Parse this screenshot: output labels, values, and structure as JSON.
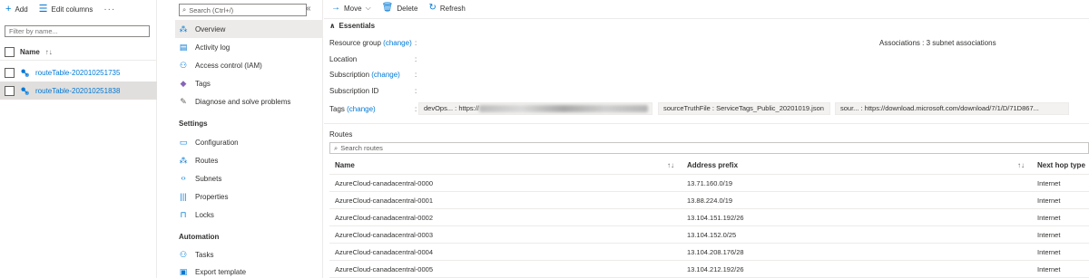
{
  "left_panel": {
    "add_label": "Add",
    "edit_columns_label": "Edit columns",
    "more_label": "···",
    "filter_placeholder": "Filter by name...",
    "name_header": "Name",
    "items": [
      {
        "name": "routeTable-202010251735",
        "selected": false
      },
      {
        "name": "routeTable-202010251838",
        "selected": true
      }
    ]
  },
  "nav": {
    "search_placeholder": "Search (Ctrl+/)",
    "collapse": "«",
    "items": [
      {
        "label": "Overview",
        "icon": "routes-icon"
      },
      {
        "label": "Activity log",
        "icon": "activity-log-icon"
      },
      {
        "label": "Access control (IAM)",
        "icon": "iam-icon"
      },
      {
        "label": "Tags",
        "icon": "tag-icon"
      },
      {
        "label": "Diagnose and solve problems",
        "icon": "wrench-icon"
      }
    ],
    "settings_title": "Settings",
    "settings_items": [
      {
        "label": "Configuration",
        "icon": "configuration-icon"
      },
      {
        "label": "Routes",
        "icon": "routes-icon"
      },
      {
        "label": "Subnets",
        "icon": "subnets-icon"
      },
      {
        "label": "Properties",
        "icon": "properties-icon"
      },
      {
        "label": "Locks",
        "icon": "lock-icon"
      }
    ],
    "automation_title": "Automation",
    "automation_items": [
      {
        "label": "Tasks",
        "icon": "tasks-icon"
      },
      {
        "label": "Export template",
        "icon": "export-template-icon"
      }
    ]
  },
  "toolbar": {
    "move_label": "Move",
    "delete_label": "Delete",
    "refresh_label": "Refresh"
  },
  "essentials": {
    "title": "Essentials",
    "change_label": "(change)",
    "resource_group_label": "Resource group",
    "location_label": "Location",
    "subscription_label": "Subscription",
    "subscription_id_label": "Subscription ID",
    "tags_label": "Tags",
    "colon": ":",
    "associations_label": "Associations",
    "associations_value": "3 subnet associations",
    "tags": [
      {
        "text": "devOps... : https://"
      },
      {
        "text": "sourceTruthFile : ServiceTags_Public_20201019.json"
      },
      {
        "text": "sour... : https://download.microsoft.com/download/7/1/D/71D867..."
      }
    ]
  },
  "routes": {
    "title": "Routes",
    "search_placeholder": "Search routes",
    "columns": [
      "Name",
      "Address prefix",
      "Next hop type"
    ],
    "rows": [
      {
        "name": "AzureCloud-canadacentral-0000",
        "prefix": "13.71.160.0/19",
        "hop": "Internet"
      },
      {
        "name": "AzureCloud-canadacentral-0001",
        "prefix": "13.88.224.0/19",
        "hop": "Internet"
      },
      {
        "name": "AzureCloud-canadacentral-0002",
        "prefix": "13.104.151.192/26",
        "hop": "Internet"
      },
      {
        "name": "AzureCloud-canadacentral-0003",
        "prefix": "13.104.152.0/25",
        "hop": "Internet"
      },
      {
        "name": "AzureCloud-canadacentral-0004",
        "prefix": "13.104.208.176/28",
        "hop": "Internet"
      },
      {
        "name": "AzureCloud-canadacentral-0005",
        "prefix": "13.104.212.192/26",
        "hop": "Internet"
      }
    ]
  },
  "colors": {
    "accent": "#0078d4",
    "selected_bg": "#e1dfdd",
    "text": "#323130"
  }
}
